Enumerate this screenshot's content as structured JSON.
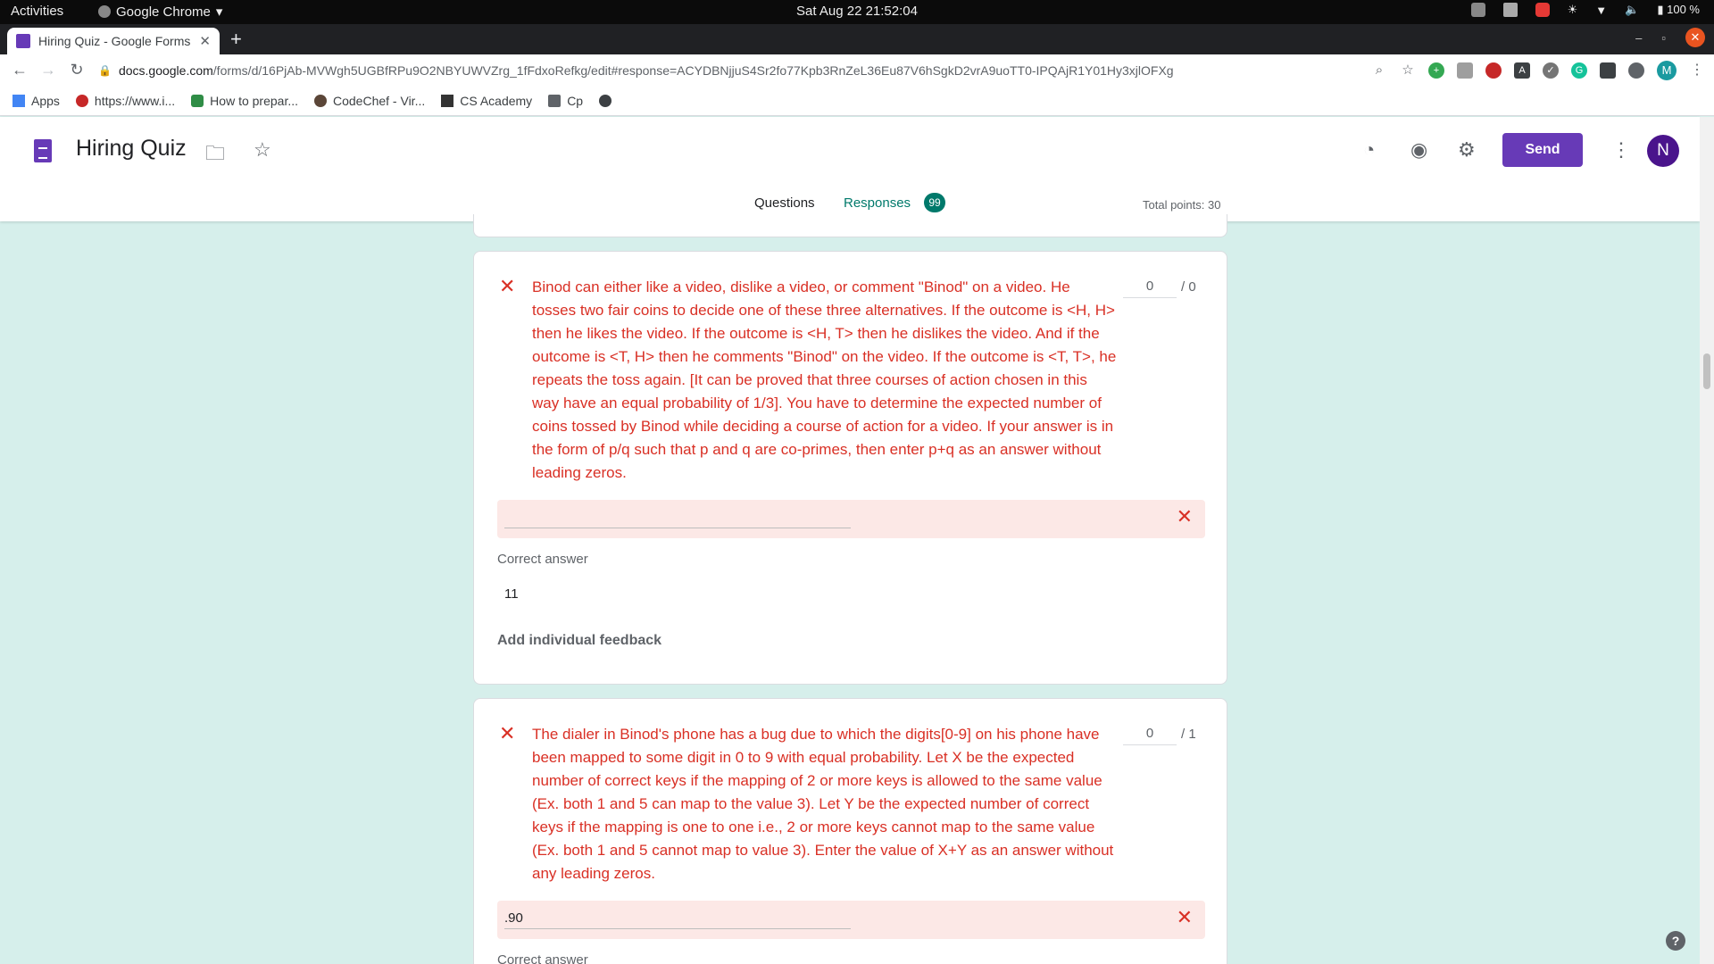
{
  "system": {
    "activities": "Activities",
    "app_name": "Google Chrome",
    "clock": "Sat Aug 22  21:52:04",
    "battery": "100 %"
  },
  "browser": {
    "tab_title": "Hiring Quiz - Google Forms",
    "url_host": "docs.google.com",
    "url_path": "/forms/d/16PjAb-MVWgh5UGBfRPu9O2NBYUWVZrg_1fFdxoRefkg/edit#response=ACYDBNjjuS4Sr2fo77Kpb3RnZeL36Eu87V6hSgkD2vrA9uoTT0-IPQAjR1Y01Hy3xjlOFXg",
    "profile_initial": "M",
    "bookmarks": [
      "Apps",
      "https://www.i...",
      "How to prepar...",
      "CodeChef - Vir...",
      "CS Academy",
      "Cp"
    ]
  },
  "form": {
    "title": "Hiring Quiz",
    "send_label": "Send",
    "avatar_initial": "N",
    "tabs": {
      "questions": "Questions",
      "responses": "Responses",
      "responses_count": "99"
    },
    "total_points": "Total points: 30"
  },
  "questions": [
    {
      "text": "Binod can either like a video, dislike a video, or comment \"Binod\" on a video. He tosses two fair coins to decide one of these three alternatives. If the outcome is <H, H> then he likes the video. If the outcome is <H, T> then he dislikes the video. And if the outcome is <T, H> then he comments \"Binod\" on the video. If the outcome is <T, T>, he repeats the toss again. [It can be proved that three courses of action chosen in this way have an equal probability of 1/3]. You have to determine the expected number of coins tossed by Binod while deciding a course of action for a video. If your answer is in the form of p/q such that p and q are co-primes, then enter p+q as an answer without leading zeros.",
      "score": "0",
      "max": "/ 0",
      "answer": "",
      "correct_label": "Correct answer",
      "correct_value": "11",
      "feedback_label": "Add individual feedback"
    },
    {
      "text": "The dialer in Binod's phone has a bug due to which the digits[0-9] on his phone have been mapped to some digit in 0 to 9 with equal probability. Let X be the expected number of correct keys if the mapping of 2 or more keys is allowed to the same value (Ex. both 1 and 5 can map to the value 3). Let Y be the expected number of correct keys if the mapping is one to one i.e., 2 or more keys cannot map to the same value (Ex. both 1 and 5 cannot map to value 3). Enter the value of X+Y as an answer without any leading zeros.",
      "score": "0",
      "max": "/ 1",
      "answer": ".90",
      "correct_label": "Correct answer"
    }
  ],
  "colors": {
    "accent": "#673ab7",
    "teal": "#00796b",
    "error": "#d93025",
    "background": "#d6efeb"
  },
  "icons": [
    "folder-icon",
    "star-icon",
    "palette-icon",
    "preview-eye-icon",
    "settings-gear-icon",
    "more-vert-icon",
    "close-x-icon",
    "help-icon"
  ]
}
